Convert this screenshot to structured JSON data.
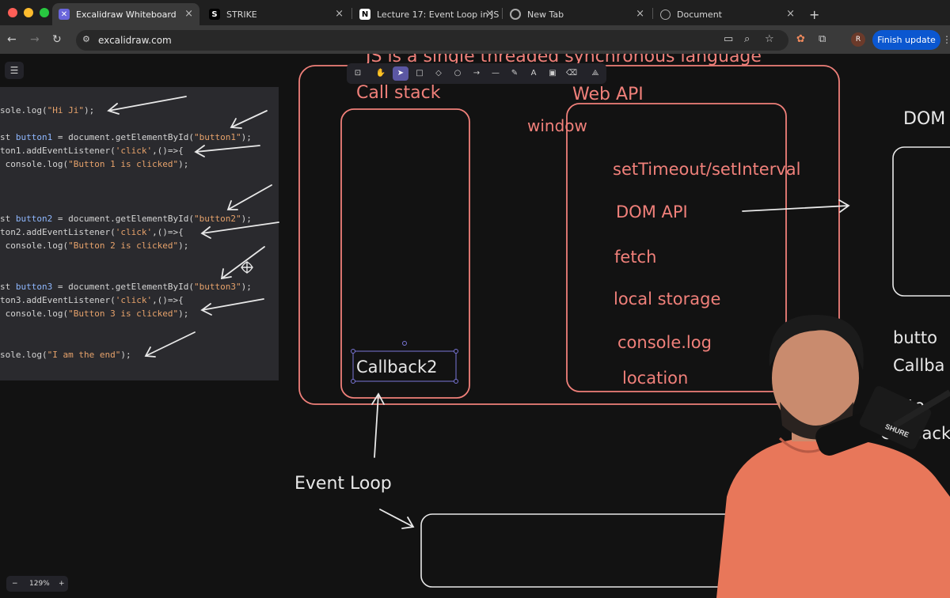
{
  "browser": {
    "tabs": [
      {
        "title": "Excalidraw Whiteboard",
        "active": true
      },
      {
        "title": "STRIKE",
        "active": false
      },
      {
        "title": "Lecture 17: Event Loop in JS",
        "active": false
      },
      {
        "title": "New Tab",
        "active": false
      },
      {
        "title": "Document",
        "active": false
      }
    ],
    "url": "excalidraw.com",
    "update_button": "Finish update",
    "avatar_letter": "R"
  },
  "code": [
    {
      "text": "sole.log(\"Hi Ji\");"
    },
    {
      "text": "st button1 = document.getElementById(\"button1\");"
    },
    {
      "text": "ton1.addEventListener('click',()=>{"
    },
    {
      "text": " console.log(\"Button 1 is clicked\");"
    },
    {
      "text": "st button2 = document.getElementById(\"button2\");"
    },
    {
      "text": "ton2.addEventListener('click',()=>{"
    },
    {
      "text": " console.log(\"Button 2 is clicked\");"
    },
    {
      "text": "st button3 = document.getElementById(\"button3\");"
    },
    {
      "text": "ton3.addEventListener('click',()=>{"
    },
    {
      "text": " console.log(\"Button 3 is clicked\");"
    },
    {
      "text": "sole.log(\"I am the end\");"
    }
  ],
  "whiteboard": {
    "title": "JS is a single threaded synchronous language",
    "call_stack": "Call stack",
    "web_api": "Web API",
    "window": "window",
    "api_items": [
      "setTimeout/setInterval",
      "DOM API",
      "fetch",
      "local storage",
      "console.log",
      "location"
    ],
    "callback": "Callback2",
    "event_loop": "Event Loop",
    "dom_label": "DOM",
    "right_labels": [
      "butto",
      "Callba",
      "butto",
      "Callback"
    ]
  },
  "zoom": {
    "minus": "−",
    "level": "129%",
    "plus": "+"
  },
  "colors": {
    "ink_red": "#f0807a",
    "ink_white": "#e8e8e8",
    "selection": "#7a76d8"
  }
}
